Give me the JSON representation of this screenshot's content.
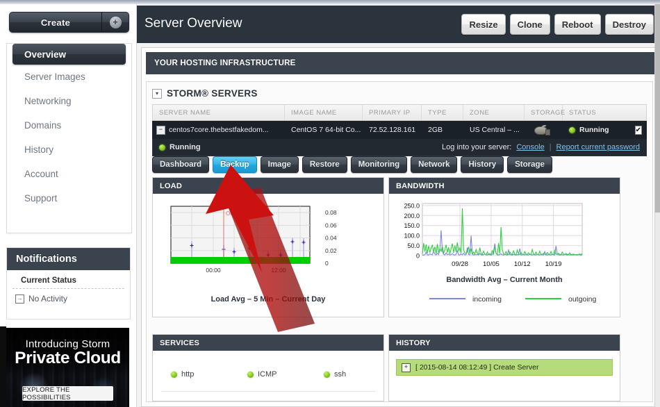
{
  "sidebar": {
    "create_label": "Create",
    "create_plus": "+",
    "items": [
      {
        "label": "Overview",
        "active": true
      },
      {
        "label": "Server Images",
        "active": false
      },
      {
        "label": "Networking",
        "active": false
      },
      {
        "label": "Domains",
        "active": false
      },
      {
        "label": "History",
        "active": false
      },
      {
        "label": "Account",
        "active": false
      },
      {
        "label": "Support",
        "active": false
      }
    ],
    "notifications": {
      "title": "Notifications",
      "subtitle": "Current Status",
      "status_text": "No Activity",
      "status_icon": "arrow-right-box-icon"
    },
    "promo": {
      "line1": "Introducing Storm",
      "line2": "Private Cloud",
      "button": "EXPLORE THE POSSIBILITIES"
    }
  },
  "header": {
    "title": "Server Overview",
    "buttons": [
      "Resize",
      "Clone",
      "Reboot",
      "Destroy"
    ]
  },
  "section": {
    "banner": "YOUR HOSTING INFRASTRUCTURE",
    "panel_title": "STORM® SERVERS",
    "toggle_glyph": "▾"
  },
  "table": {
    "columns": [
      "SERVER NAME",
      "IMAGE NAME",
      "PRIMARY IP",
      "TYPE",
      "ZONE",
      "STORAGE",
      "STATUS"
    ],
    "row": {
      "expand_glyph": "−",
      "server_name": "centos7core.thebestfakedom...",
      "image_name": "CentOS 7 64-bit Co...",
      "primary_ip": "72.52.128.161",
      "type": "2GB",
      "zone": "US Central – ...",
      "storage_icon": "hard-disk-icon",
      "status": "Running",
      "checkbox_glyph": "✔"
    },
    "detail": {
      "status": "Running",
      "login_label": "Log into your server:",
      "console_link": "Console",
      "password_link": "Report current password",
      "divider": "|"
    }
  },
  "tabs": [
    {
      "label": "Dashboard",
      "selected": false
    },
    {
      "label": "Backup",
      "selected": true
    },
    {
      "label": "Image",
      "selected": false
    },
    {
      "label": "Restore",
      "selected": false
    },
    {
      "label": "Monitoring",
      "selected": false
    },
    {
      "label": "Network",
      "selected": false
    },
    {
      "label": "History",
      "selected": false
    },
    {
      "label": "Storage",
      "selected": false
    }
  ],
  "widgets": {
    "load": {
      "header": "LOAD",
      "annotation": "Oct 21"
    },
    "bandwidth": {
      "header": "BANDWIDTH"
    },
    "services": {
      "header": "SERVICES",
      "items": [
        {
          "name": "http",
          "status_icon": "green-dot-icon"
        },
        {
          "name": "ICMP",
          "status_icon": "green-dot-icon"
        },
        {
          "name": "ssh",
          "status_icon": "green-dot-icon"
        }
      ]
    },
    "history": {
      "header": "HISTORY",
      "entries": [
        {
          "expand_glyph": "+",
          "text": "[ 2015-08-14 08:12:49 ] Create Server"
        }
      ]
    }
  },
  "chart_data": [
    {
      "type": "line",
      "title": "Load Avg – 5 Min – Current Day",
      "xlabel": "",
      "ylabel": "",
      "ylim": [
        0,
        0.09
      ],
      "yticks": [
        "0",
        "0.02",
        "0.04",
        "0.06",
        "0.08"
      ],
      "ytick_values": [
        0,
        0.02,
        0.04,
        0.06,
        0.08
      ],
      "xticks": [
        "00:00",
        "12:00"
      ],
      "grid": true,
      "annotations": [
        {
          "text": "Oct 21",
          "color": "#ef6b6b",
          "x_frac": 0.38
        }
      ],
      "series": [
        {
          "name": "load-spikes",
          "color": "#2222cc",
          "x_frac": [
            0.15,
            0.38,
            0.455,
            0.565,
            0.7,
            0.79,
            0.875,
            0.955
          ],
          "values": [
            0.028,
            0.022,
            0.018,
            0.024,
            0.013,
            0.013,
            0.034,
            0.033
          ]
        },
        {
          "name": "baseline",
          "color": "#0000ee",
          "values": [
            0.006
          ]
        },
        {
          "name": "floor",
          "color": "#00cc00",
          "values": [
            0.002
          ]
        }
      ]
    },
    {
      "type": "line",
      "title": "Bandwidth Avg – Current Month",
      "xlabel": "",
      "ylabel": "",
      "ylim": [
        0,
        260
      ],
      "yticks": [
        "0",
        "50.0",
        "100.0",
        "150.0",
        "200.0",
        "250.0"
      ],
      "ytick_values": [
        0,
        50,
        100,
        150,
        200,
        250
      ],
      "xticks": [
        "09/28",
        "10/05",
        "10/12",
        "10/19"
      ],
      "xtick_fracs": [
        0.235,
        0.43,
        0.625,
        0.82
      ],
      "grid": true,
      "legend": [
        {
          "name": "incoming",
          "color": "#7b85e8"
        },
        {
          "name": "outgoing",
          "color": "#2fcd43"
        }
      ],
      "series": [
        {
          "name": "incoming",
          "color": "#7b85e8",
          "values": [
            3,
            2,
            5,
            18,
            4,
            3,
            9,
            6,
            4,
            22,
            7,
            3,
            12,
            5,
            30,
            126,
            20,
            6,
            3,
            14,
            4,
            8,
            3,
            5,
            10,
            4,
            3,
            6,
            25,
            4,
            3,
            8,
            4,
            12,
            3,
            5,
            40,
            6,
            4,
            100,
            8,
            3,
            5,
            4,
            6,
            3,
            10,
            4,
            3,
            5,
            8,
            4,
            3,
            6,
            4,
            3,
            5,
            20,
            60,
            12,
            4,
            3,
            5,
            8,
            4,
            3,
            6,
            4,
            3,
            28,
            5,
            4,
            3,
            6,
            4,
            3,
            5,
            4,
            35,
            3,
            4,
            6,
            3,
            5,
            4,
            3,
            8,
            4,
            3,
            5,
            4,
            3,
            6,
            4,
            3,
            5,
            4,
            3,
            20,
            4,
            3,
            5,
            4,
            3,
            6,
            4,
            3,
            48,
            10,
            4,
            3,
            5,
            4,
            3,
            6,
            4,
            3,
            5,
            4,
            3,
            4,
            3,
            5,
            4,
            3,
            6,
            4,
            3,
            5
          ]
        },
        {
          "name": "outgoing",
          "color": "#2fcd43",
          "values": [
            8,
            62,
            20,
            55,
            12,
            48,
            15,
            40,
            52,
            18,
            44,
            10,
            58,
            14,
            35,
            22,
            46,
            12,
            30,
            54,
            16,
            42,
            8,
            36,
            60,
            14,
            50,
            18,
            66,
            24,
            40,
            12,
            236,
            28,
            14,
            8,
            20,
            44,
            10,
            35,
            6,
            18,
            8,
            30,
            12,
            6,
            40,
            10,
            5,
            22,
            8,
            4,
            18,
            6,
            10,
            5,
            25,
            8,
            46,
            12,
            4,
            62,
            10,
            142,
            30,
            8,
            5,
            20,
            6,
            4,
            18,
            8,
            5,
            24,
            6,
            4,
            28,
            8,
            5,
            16,
            6,
            4,
            20,
            8,
            5,
            14,
            6,
            4,
            30,
            8,
            5,
            18,
            6,
            4,
            22,
            8,
            5,
            12,
            6,
            4,
            16,
            8,
            5,
            20,
            6,
            4,
            26,
            8,
            5,
            12,
            6,
            4,
            18,
            8,
            5,
            10,
            6,
            4,
            14,
            6,
            4,
            8,
            5,
            4,
            6,
            4,
            8,
            5,
            10
          ]
        }
      ]
    }
  ],
  "colors": {
    "accent_blue": "#35b4e6",
    "dark_panel": "#3a434e",
    "dark_header": "#2b333d",
    "row_dark": "#1b2129",
    "green": "#2fcd43",
    "blue_line": "#7b85e8",
    "history_green": "#b5db7a",
    "arrow_red": "#cc1111"
  }
}
